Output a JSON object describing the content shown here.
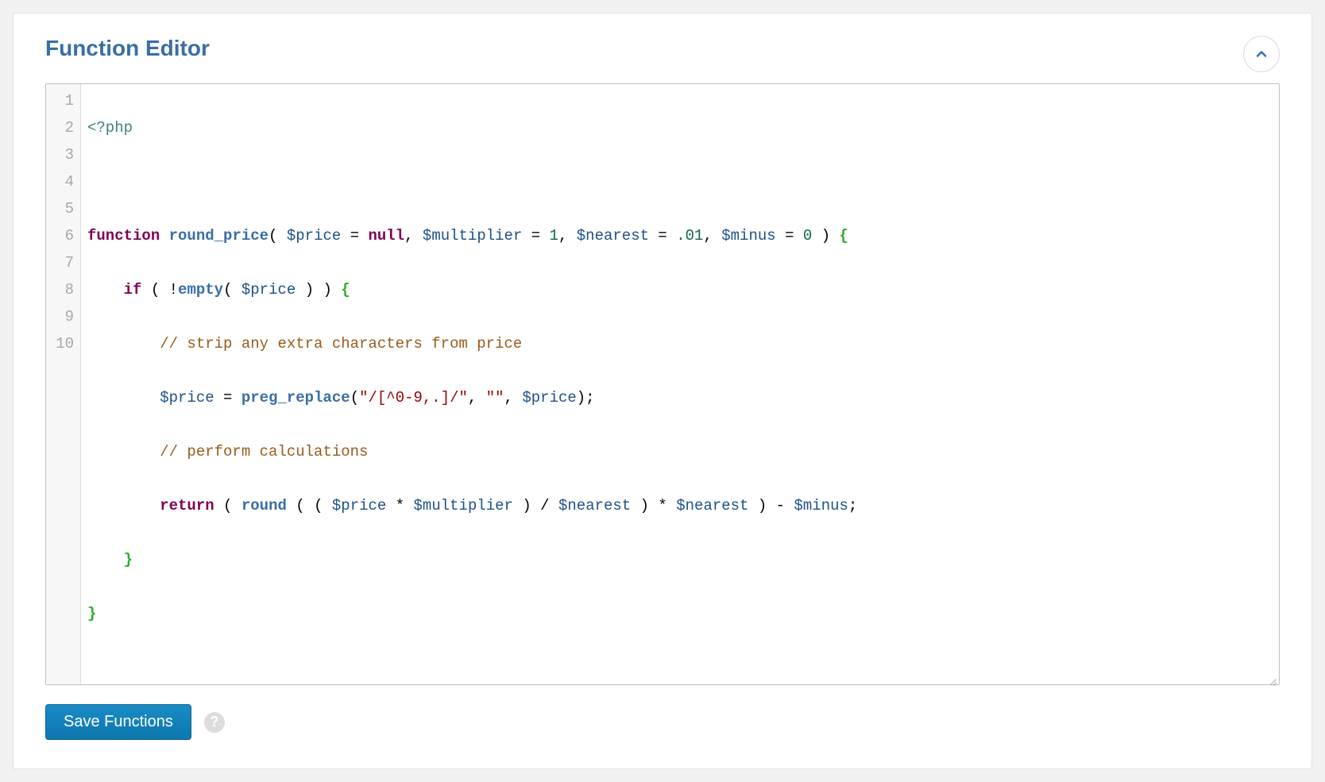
{
  "panel": {
    "title": "Function Editor",
    "save_label": "Save Functions"
  },
  "editor": {
    "line_numbers": [
      "1",
      "2",
      "3",
      "4",
      "5",
      "6",
      "7",
      "8",
      "9",
      "10"
    ],
    "code": {
      "l1": {
        "open": "<?php"
      },
      "l3": {
        "kw_function": "function",
        "fn_name": "round_price",
        "p1": "$price",
        "eq1": "=",
        "v1": "null",
        "p2": "$multiplier",
        "eq2": "=",
        "v2": "1",
        "p3": "$nearest",
        "eq3": "=",
        "v3": ".01",
        "p4": "$minus",
        "eq4": "=",
        "v4": "0"
      },
      "l4": {
        "kw_if": "if",
        "bang": "!",
        "fn_empty": "empty",
        "var": "$price"
      },
      "l5": {
        "comment": "// strip any extra characters from price"
      },
      "l6": {
        "lhs": "$price",
        "assign": "=",
        "fn": "preg_replace",
        "arg1": "\"/[^0-9,.]/\"",
        "arg2": "\"\"",
        "arg3": "$price"
      },
      "l7": {
        "comment": "// perform calculations"
      },
      "l8": {
        "kw_return": "return",
        "fn_round": "round",
        "a": "$price",
        "op1": "*",
        "b": "$multiplier",
        "op2": "/",
        "c": "$nearest",
        "op3": "*",
        "d": "$nearest",
        "op4": "-",
        "e": "$minus"
      }
    }
  }
}
